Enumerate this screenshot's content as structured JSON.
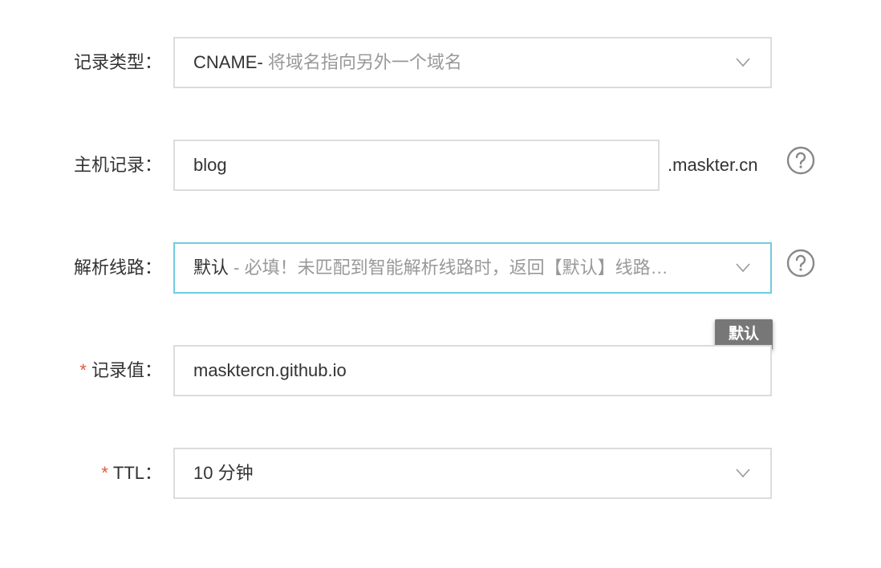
{
  "form": {
    "record_type": {
      "label": "记录类型：",
      "value_prefix": "CNAME-",
      "value_desc": " 将域名指向另外一个域名",
      "icon": "chevron-down-icon"
    },
    "host_record": {
      "label": "主机记录：",
      "value": "blog",
      "suffix": ".maskter.cn",
      "help_icon": "question-circle-icon"
    },
    "resolution_line": {
      "label": "解析线路：",
      "value_main": "默认",
      "value_desc": " - 必填！未匹配到智能解析线路时，返回【默认】线路…",
      "icon": "chevron-down-icon",
      "help_icon": "question-circle-icon",
      "tooltip": "默认"
    },
    "record_value": {
      "required_mark": "*",
      "label": "记录值：",
      "value": "maskter​cn.github.io"
    },
    "ttl": {
      "required_mark": "*",
      "label": "TTL：",
      "value": "10 分钟",
      "icon": "chevron-down-icon"
    }
  },
  "colors": {
    "border": "#dcdcdc",
    "focus_border": "#6fcde0",
    "required": "#e2583e",
    "text": "#333333",
    "muted_text": "#999999",
    "tooltip_bg": "#777777"
  }
}
